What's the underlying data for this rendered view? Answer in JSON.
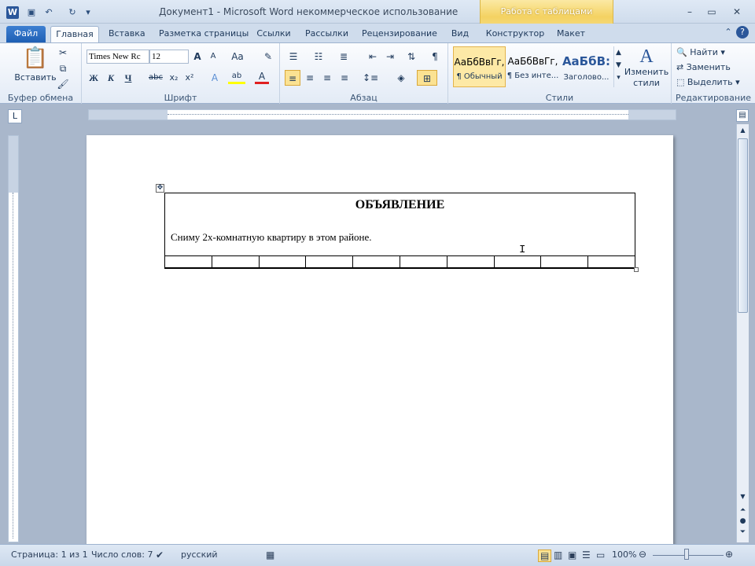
{
  "titlebar": {
    "title": "Документ1  -  Microsoft Word некоммерческое использование",
    "context_group": "Работа с таблицами"
  },
  "tabs": [
    "Файл",
    "Главная",
    "Вставка",
    "Разметка страницы",
    "Ссылки",
    "Рассылки",
    "Рецензирование",
    "Вид",
    "Конструктор",
    "Макет"
  ],
  "clipboard": {
    "paste_label": "Вставить",
    "group": "Буфер обмена"
  },
  "font": {
    "name": "Times New Rc",
    "size": "12",
    "group": "Шрифт"
  },
  "paragraph": {
    "group": "Абзац"
  },
  "styles": {
    "group": "Стили",
    "items": [
      {
        "sample": "АаБбВвГг,",
        "name": "¶ Обычный"
      },
      {
        "sample": "АаБбВвГг,",
        "name": "¶ Без инте..."
      },
      {
        "sample": "АаБбВ:",
        "name": "Заголово..."
      }
    ],
    "change_label_1": "Изменить",
    "change_label_2": "стили"
  },
  "editing": {
    "find": "Найти",
    "replace": "Заменить",
    "select": "Выделить",
    "group": "Редактирование"
  },
  "document": {
    "title": "ОБЪЯВЛЕНИЕ",
    "text": "Сниму 2х-комнатную квартиру в этом районе."
  },
  "statusbar": {
    "page": "Страница: 1 из 1",
    "words": "Число слов: 7",
    "language": "русский",
    "zoom": "100%"
  },
  "colors": {
    "accent": "#2b579a",
    "context": "#f4d262"
  },
  "icons": [
    "word-logo-icon",
    "save-icon",
    "undo-icon",
    "redo-icon",
    "cut-icon",
    "copy-icon",
    "format-painter-icon",
    "bullets-icon",
    "find-icon",
    "replace-icon",
    "select-icon",
    "table-move-icon"
  ]
}
